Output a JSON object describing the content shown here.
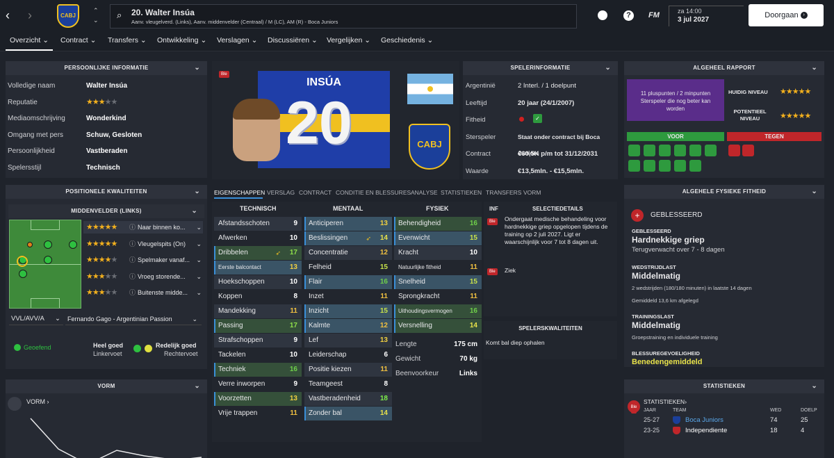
{
  "header": {
    "player_name": "20. Walter Insúa",
    "positions": "Aanv. vleugelverd. (Links), Aanv. middenvelder (Centraal) / M (LC), AM (R) - Boca Juniors",
    "date_day": "za 14:00",
    "date": "3 jul 2027",
    "continue_label": "Doorgaan",
    "club_badge": "CABJ",
    "help_glyph": "?",
    "fm_label": "FM"
  },
  "tabs": [
    "Overzicht",
    "Contract",
    "Transfers",
    "Ontwikkeling",
    "Verslagen",
    "Discussiëren",
    "Vergelijken",
    "Geschiedenis"
  ],
  "personal": {
    "title": "PERSOONLIJKE INFORMATIE",
    "rows": [
      {
        "label": "Volledige naam",
        "value": "Walter Insúa"
      },
      {
        "label": "Reputatie",
        "stars": 3
      },
      {
        "label": "Mediaomschrijving",
        "value": "Wonderkind"
      },
      {
        "label": "Omgang met pers",
        "value": "Schuw, Gesloten"
      },
      {
        "label": "Persoonlijkheid",
        "value": "Vastberaden"
      },
      {
        "label": "Spelersstijl",
        "value": "Technisch"
      }
    ]
  },
  "positional": {
    "title": "POSITIONELE KWALITEITEN",
    "sub": "MIDDENVELDER (LINKS)",
    "roles": [
      {
        "stars": 4.5,
        "name": "Naar binnen ko..."
      },
      {
        "stars": 4.5,
        "name": "Vleugelspits (On)"
      },
      {
        "stars": 4,
        "name": "Spelmaker vanaf..."
      },
      {
        "stars": 3,
        "name": "Vroeg storende..."
      },
      {
        "stars": 3,
        "name": "Buitenste midde..."
      }
    ],
    "duty": "VVL/AVV/A",
    "style": "Fernando Gago - Argentinian Passion",
    "trained": "Geoefend",
    "left_foot_rating": "Heel goed",
    "left_foot": "Linkervoet",
    "right_foot_rating": "Redelijk goed",
    "right_foot": "Rechtervoet"
  },
  "form": {
    "title": "VORM",
    "label": "VORM"
  },
  "card": {
    "shirt_name": "INSÚA",
    "number": "20",
    "tag": "Ble"
  },
  "playerinfo": {
    "title": "SPELERINFORMATIE",
    "rows": [
      {
        "label": "Argentinië",
        "value": "2 Interl. / 1 doelpunt"
      },
      {
        "label": "Leeftijd",
        "value": "20 jaar (24/1/2007)"
      },
      {
        "label": "Fitheid",
        "value": ""
      },
      {
        "label": "Sterspeler",
        "value": "Staat onder contract bij Boca Juniors"
      },
      {
        "label": "Contract",
        "value": "€60,5K p/m tot 31/12/2031"
      },
      {
        "label": "Waarde",
        "value": "€13,5mln. - €15,5mln."
      }
    ]
  },
  "subtabs": [
    "EIGENSCHAPPEN",
    "VERSLAG",
    "CONTRACT",
    "CONDITIE EN BLESSURES",
    "ANALYSE",
    "STATISTIEKEN",
    "TRANSFERS",
    "VORM"
  ],
  "attributes": {
    "technisch": {
      "title": "TECHNISCH",
      "items": [
        [
          "Afstandsschoten",
          9
        ],
        [
          "Afwerken",
          10
        ],
        [
          "Dribbelen",
          17
        ],
        [
          "Eerste balcontact",
          13
        ],
        [
          "Hoekschoppen",
          10
        ],
        [
          "Koppen",
          8
        ],
        [
          "Mandekking",
          11
        ],
        [
          "Passing",
          17
        ],
        [
          "Strafschoppen",
          9
        ],
        [
          "Tackelen",
          10
        ],
        [
          "Techniek",
          16
        ],
        [
          "Verre inworpen",
          9
        ],
        [
          "Voorzetten",
          13
        ],
        [
          "Vrije trappen",
          11
        ]
      ]
    },
    "mentaal": {
      "title": "MENTAAL",
      "items": [
        [
          "Anticiperen",
          13
        ],
        [
          "Beslissingen",
          14
        ],
        [
          "Concentratie",
          12
        ],
        [
          "Felheid",
          15
        ],
        [
          "Flair",
          16
        ],
        [
          "Inzet",
          11
        ],
        [
          "Inzicht",
          15
        ],
        [
          "Kalmte",
          12
        ],
        [
          "Lef",
          13
        ],
        [
          "Leiderschap",
          6
        ],
        [
          "Positie kiezen",
          11
        ],
        [
          "Teamgeest",
          8
        ],
        [
          "Vastberadenheid",
          18
        ],
        [
          "Zonder bal",
          14
        ]
      ]
    },
    "fysiek": {
      "title": "FYSIEK",
      "items": [
        [
          "Behendigheid",
          16
        ],
        [
          "Evenwicht",
          15
        ],
        [
          "Kracht",
          10
        ],
        [
          "Natuurlijke fitheid",
          11
        ],
        [
          "Snelheid",
          15
        ],
        [
          "Sprongkracht",
          11
        ],
        [
          "Uithoudingsvermogen",
          16
        ],
        [
          "Versnelling",
          14
        ]
      ]
    },
    "length_label": "Lengte",
    "length": "175 cm",
    "weight_label": "Gewicht",
    "weight": "70 kg",
    "foot_label": "Beenvoorkeur",
    "foot": "Links"
  },
  "selection": {
    "inf": "INF",
    "title": "SELECTIEDETAILS",
    "tag": "Ble",
    "text": "Ondergaat medische behandeling voor hardnekkige griep opgelopen tijdens de training op 2 juli 2027. Ligt er waarschijnlijk voor 7 tot 8 dagen uit.",
    "sick_label": "Ziek",
    "qual_title": "SPELERSKWALITEITEN",
    "qual": "Komt bal diep ophalen"
  },
  "report": {
    "title": "ALGEHEEL RAPPORT",
    "summary": "11 pluspunten / 2 minpunten",
    "note": "Sterspeler die nog beter kan worden",
    "current_label": "HUIDIG NIVEAU",
    "current_stars": 4.5,
    "potential_label": "POTENTIEEL NIVEAU",
    "potential_stars": 4.5,
    "pro_label": "VOOR",
    "con_label": "TEGEN"
  },
  "fitness": {
    "title": "ALGEHELE FYSIEKE FITHEID",
    "status": "GEBLESSEERD",
    "injury_label": "GEBLESSEERD",
    "injury": "Hardnekkige griep",
    "expected": "Terugverwacht over 7 - 8 dagen",
    "match_label": "WEDSTRIJDLAST",
    "match": "Middelmatig",
    "match_note": "2 wedstrijden (180/180 minuten) in laatste 14 dagen",
    "match_note2": "Gemiddeld 13,6 km afgelegd",
    "train_label": "TRAININGSLAST",
    "train": "Middelmatig",
    "train_note": "Groepstraining en individuele training",
    "risk_label": "BLESSUREGEVOELIGHEID",
    "risk": "Benedengemiddeld"
  },
  "stats": {
    "title": "STATISTIEKEN",
    "link": "STATISTIEKEN",
    "col_year": "JAAR",
    "col_team": "TEAM",
    "col_apps": "WED",
    "col_goals": "DOELP",
    "tag": "Ble",
    "rows": [
      {
        "year": "25-27",
        "team": "Boca Juniors",
        "apps": "74",
        "goals": "25"
      },
      {
        "year": "23-25",
        "team": "Independiente",
        "apps": "18",
        "goals": "4"
      }
    ]
  },
  "colors": {
    "accent": "#3a8fd8",
    "pro": "#2e9a3e",
    "con": "#c0262a",
    "report_bg": "#5a2d8a"
  }
}
